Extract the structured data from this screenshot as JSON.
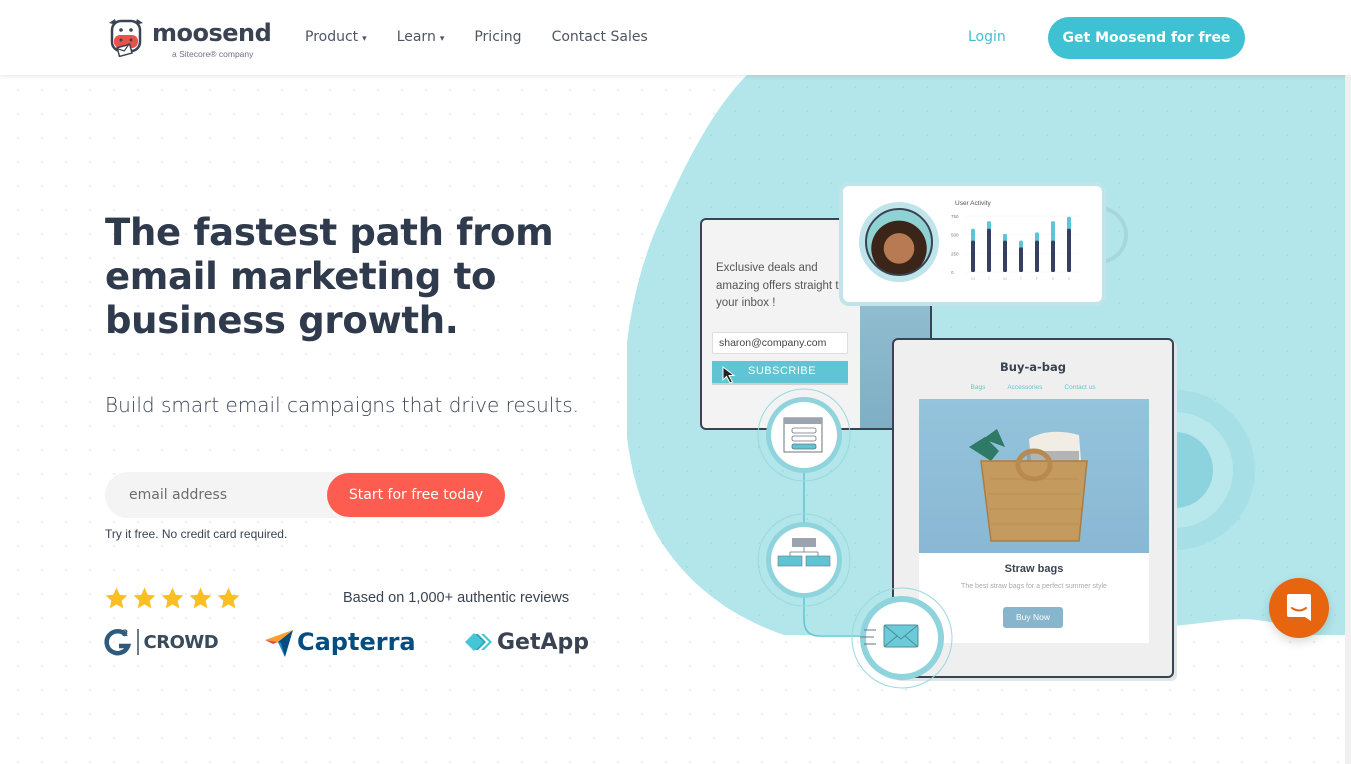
{
  "header": {
    "logo_text": "moosend",
    "logo_subtext": "a Sitecore® company",
    "nav": [
      {
        "label": "Product",
        "has_dropdown": true
      },
      {
        "label": "Learn",
        "has_dropdown": true
      },
      {
        "label": "Pricing",
        "has_dropdown": false
      },
      {
        "label": "Contact Sales",
        "has_dropdown": false
      }
    ],
    "dropdown_glyph": "▾",
    "login_label": "Login",
    "cta_label": "Get Moosend for free"
  },
  "hero": {
    "headline_lines": [
      "The fastest path from",
      "email marketing to",
      "business growth."
    ],
    "subheadline": "Build smart email campaigns that drive results.",
    "email_placeholder": "email address",
    "email_value": "",
    "start_button": "Start for free today",
    "note": "Try it free. No credit card required.",
    "rating_stars": 5,
    "rating_max": 5,
    "reviews_text": "Based on 1,000+ authentic reviews",
    "review_badges": [
      {
        "name": "G2 Crowd",
        "label": "CROWD",
        "prefix": "G"
      },
      {
        "name": "Capterra",
        "label": "Capterra"
      },
      {
        "name": "GetApp",
        "label": "GetApp"
      }
    ]
  },
  "illustration": {
    "optin_card": {
      "text": "Exclusive deals and amazing offers straight to your inbox !",
      "email_value": "sharon@company.com",
      "subscribe_label": "SUBSCRIBE"
    },
    "activity_card": {
      "title": "User Activity",
      "y_ticks": [
        "750",
        "500",
        "250",
        "0"
      ],
      "days": [
        "M",
        "T",
        "W",
        "T",
        "F",
        "S",
        "S"
      ],
      "base_values": [
        420,
        580,
        420,
        330,
        420,
        420,
        580
      ],
      "total_values": [
        580,
        680,
        510,
        420,
        530,
        680,
        740
      ],
      "y_max": 750
    },
    "shop_card": {
      "title": "Buy-a-bag",
      "nav": [
        "Bags",
        "Accessories",
        "Contact us"
      ],
      "product_name": "Straw bags",
      "product_desc": "The best straw bags for a perfect summer style",
      "buy_label": "Buy Now"
    }
  },
  "colors": {
    "accent": "#3ec1d3",
    "cta_red": "#fd5d50",
    "blob": "#b2e6ea",
    "dark_text": "#2f3a4c",
    "star": "#fbbf24",
    "chat": "#e8650f"
  }
}
